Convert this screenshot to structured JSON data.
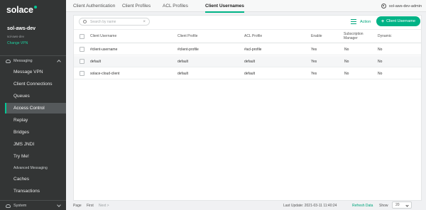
{
  "sidebar": {
    "logo": "solace",
    "service_name": "sol-aws-dev",
    "service_sub": "sol-aws-dev",
    "change_vpn": "Change VPN",
    "messaging_label": "Messaging",
    "items": [
      {
        "label": "Message VPN"
      },
      {
        "label": "Client Connections"
      },
      {
        "label": "Queues"
      },
      {
        "label": "Access Control"
      },
      {
        "label": "Replay"
      },
      {
        "label": "Bridges"
      },
      {
        "label": "JMS JNDI"
      },
      {
        "label": "Try Me!"
      },
      {
        "label": "Advanced Messaging"
      },
      {
        "label": "Caches"
      },
      {
        "label": "Transactions"
      }
    ],
    "system_label": "System"
  },
  "tabs": [
    {
      "label": "Client Authentication"
    },
    {
      "label": "Client Profiles"
    },
    {
      "label": "ACL Profiles"
    },
    {
      "label": "Client Usernames"
    }
  ],
  "user": {
    "name": "sol-aws-dev-admin"
  },
  "toolbar": {
    "search_placeholder": "Search by name",
    "action_label": "Action",
    "create_label": "Client Username"
  },
  "table": {
    "headers": {
      "username": "Client Username",
      "client_profile": "Client Profile",
      "acl_profile": "ACL Profile",
      "enable": "Enable",
      "subscription_manager": "Subscription Manager",
      "dynamic": "Dynamic"
    },
    "rows": [
      {
        "username": "#client-username",
        "client_profile": "#client-profile",
        "acl_profile": "#acl-profile",
        "enable": "Yes",
        "subscription_manager": "No",
        "dynamic": "No"
      },
      {
        "username": "default",
        "client_profile": "default",
        "acl_profile": "default",
        "enable": "Yes",
        "subscription_manager": "No",
        "dynamic": "No"
      },
      {
        "username": "solace-cloud-client",
        "client_profile": "default",
        "acl_profile": "default",
        "enable": "Yes",
        "subscription_manager": "No",
        "dynamic": "No"
      }
    ]
  },
  "footer": {
    "page_label": "Page",
    "first_label": "First",
    "next_label": "Next >",
    "last_update": "Last Update: 2021-03-11 11:40:24",
    "refresh_label": "Refresh Data",
    "show_label": "Show",
    "show_value": "20"
  },
  "colors": {
    "sidebar_bg": "#333535",
    "accent": "#00b386",
    "active_item_bg": "#55595b"
  },
  "icons": {
    "messaging": "chat-bubble-icon",
    "system": "system-icon",
    "user": "user-circle-icon",
    "search": "search-icon",
    "action": "sliders-icon",
    "create": "plus-icon"
  }
}
